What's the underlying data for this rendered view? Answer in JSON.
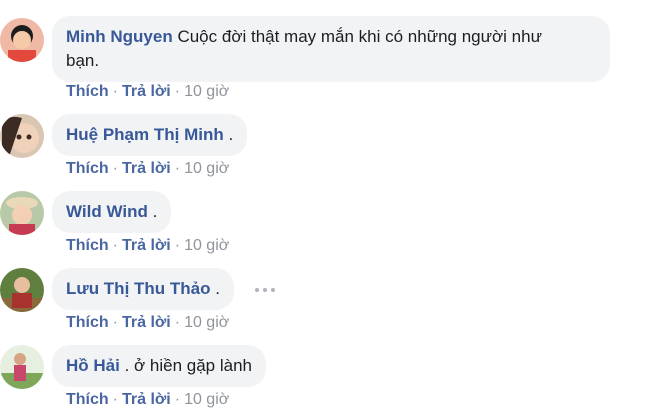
{
  "comments": [
    {
      "author": "Minh Nguyen",
      "text_line1": "Cuộc đời thật may mắn khi có những người như",
      "text_line2": "bạn.",
      "like": "Thích",
      "reply": "Trả lời",
      "time": "10 giờ"
    },
    {
      "author": "Huệ Phạm Thị Minh",
      "text": ".",
      "like": "Thích",
      "reply": "Trả lời",
      "time": "10 giờ"
    },
    {
      "author": "Wild Wind",
      "text": ".",
      "like": "Thích",
      "reply": "Trả lời",
      "time": "10 giờ"
    },
    {
      "author": "Lưu Thị Thu Thảo",
      "text": ".",
      "like": "Thích",
      "reply": "Trả lời",
      "time": "10 giờ"
    },
    {
      "author": "Hồ Hải",
      "text": ". ở hiền gặp lành",
      "like": "Thích",
      "reply": "Trả lời",
      "time": "10 giờ"
    }
  ],
  "separator": "·",
  "icons": {
    "more": "more-horizontal-icon"
  },
  "colors": {
    "author_name": "#385898",
    "action_link": "#4b67a1",
    "bubble_bg": "#f2f3f5",
    "meta_text": "#90949c"
  }
}
